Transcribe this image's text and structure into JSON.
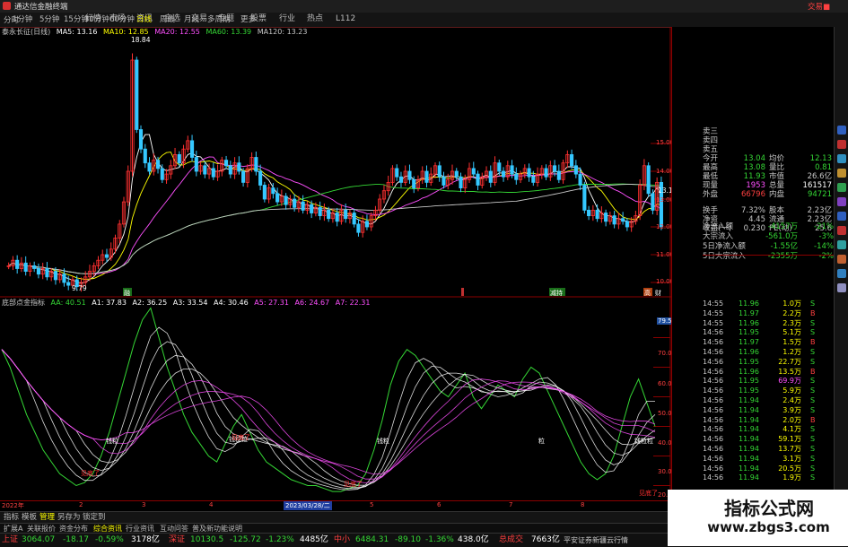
{
  "window": {
    "title": "通达信金融终端",
    "trade_link": "交易■"
  },
  "menu": [
    "行情",
    "市场",
    "资讯",
    "自选",
    "交易",
    "专题",
    "股票",
    "行业",
    "热点",
    "L112"
  ],
  "periods": [
    "分时",
    "1分钟",
    "5分钟",
    "15分钟",
    "30分钟",
    "60分钟",
    "日线",
    "周线",
    "月线",
    "多周期",
    "更多"
  ],
  "selected_period": "日线",
  "main_legend": {
    "name": "泰永长征(日线)",
    "items": [
      {
        "text": "MA5: 13.16",
        "color": "#ffffff"
      },
      {
        "text": "MA10: 12.85",
        "color": "#ffff00"
      },
      {
        "text": "MA20: 12.55",
        "color": "#ff50ff"
      },
      {
        "text": "MA60: 13.39",
        "color": "#35d835"
      },
      {
        "text": "MA120: 13.23",
        "color": "#c8c8c8"
      }
    ]
  },
  "price_axis": [
    "15.00",
    "14.00",
    "13.00",
    "12.00",
    "11.00",
    "10.00"
  ],
  "price_notes": {
    "high": "18.84",
    "low": "9.79",
    "last": "13.1"
  },
  "event_markers": [
    "融",
    "减持",
    "高",
    "财"
  ],
  "ind_legend": {
    "name": "底部点金指标",
    "items": [
      {
        "text": "AA: 40.51",
        "color": "#35d835"
      },
      {
        "text": "A1: 37.83",
        "color": "#ffffff"
      },
      {
        "text": "A2: 36.25",
        "color": "#ffffff"
      },
      {
        "text": "A3: 33.54",
        "color": "#ffffff"
      },
      {
        "text": "A4: 30.46",
        "color": "#ffffff"
      },
      {
        "text": "A5: 27.31",
        "color": "#ff50ff"
      },
      {
        "text": "A6: 24.67",
        "color": "#ff50ff"
      },
      {
        "text": "A7: 22.31",
        "color": "#ff50ff"
      }
    ]
  },
  "ind_axis": [
    "79.58",
    "70.00",
    "60.00",
    "50.00",
    "40.00",
    "30.00",
    "20.00"
  ],
  "ind_labels": [
    "见底了",
    "钱粒",
    "钱粒粒",
    "钱粒",
    "粒",
    "钱粒粒",
    "见底了",
    "见底了",
    "见底了"
  ],
  "time_axis": {
    "year": "2022年",
    "date": "2023/03/28/二",
    "marks": [
      "2",
      "3",
      "4",
      "5",
      "6",
      "7",
      "8"
    ]
  },
  "quote": {
    "bids_asks": [
      "卖三",
      "卖四",
      "卖五"
    ],
    "rows": [
      {
        "l1": "今开",
        "v1": "13.04",
        "c1": "#35d835",
        "l2": "均价",
        "v2": "12.13",
        "c2": "#35d835"
      },
      {
        "l1": "最高",
        "v1": "13.08",
        "c1": "#35d835",
        "l2": "量比",
        "v2": "0.81",
        "c2": "#35d835"
      },
      {
        "l1": "最低",
        "v1": "11.93",
        "c1": "#35d835",
        "l2": "市值",
        "v2": "26.6亿",
        "c2": "#c8c8c8"
      },
      {
        "l1": "现量",
        "v1": "1953",
        "c1": "#ff50ff",
        "l2": "总量",
        "v2": "161517",
        "c2": "#ffffff"
      },
      {
        "l1": "外盘",
        "v1": "66796",
        "c1": "#ff4040",
        "l2": "内盘",
        "v2": "94721",
        "c2": "#35d835"
      },
      {
        "l1": "换手",
        "v1": "7.32%",
        "c1": "#c8c8c8",
        "l2": "股本",
        "v2": "2.23亿",
        "c2": "#c8c8c8"
      },
      {
        "l1": "净资",
        "v1": "4.45",
        "c1": "#c8c8c8",
        "l2": "流通",
        "v2": "2.23亿",
        "c2": "#c8c8c8"
      },
      {
        "l1": "收益(一)",
        "v1": "0.230",
        "c1": "#c8c8c8",
        "l2": "PE(动)",
        "v2": "25.6",
        "c2": "#c8c8c8"
      }
    ],
    "flows": [
      {
        "label": "净流入额",
        "value": "-4157万",
        "pct": "-21%"
      },
      {
        "label": "大宗流入",
        "value": "-561.0万",
        "pct": "-3%"
      },
      {
        "label": "5日净流入额",
        "value": "-1.55亿",
        "pct": "-14%"
      },
      {
        "label": "5日大宗流入",
        "value": "-2355万",
        "pct": "-2%"
      }
    ]
  },
  "ticks": [
    {
      "t": "14:55",
      "p": "11.96",
      "v": "1.0万",
      "s": "S",
      "pc": "#35d835",
      "vc": "#ffff00",
      "sc": "#35d835"
    },
    {
      "t": "14:55",
      "p": "11.97",
      "v": "2.2万",
      "s": "B",
      "pc": "#35d835",
      "vc": "#ffff00",
      "sc": "#ff4040"
    },
    {
      "t": "14:55",
      "p": "11.96",
      "v": "2.3万",
      "s": "S",
      "pc": "#35d835",
      "vc": "#ffff00",
      "sc": "#35d835"
    },
    {
      "t": "14:56",
      "p": "11.95",
      "v": "5.1万",
      "s": "S",
      "pc": "#35d835",
      "vc": "#ffff00",
      "sc": "#35d835"
    },
    {
      "t": "14:56",
      "p": "11.97",
      "v": "1.5万",
      "s": "B",
      "pc": "#35d835",
      "vc": "#ffff00",
      "sc": "#ff4040"
    },
    {
      "t": "14:56",
      "p": "11.96",
      "v": "1.2万",
      "s": "S",
      "pc": "#35d835",
      "vc": "#ffff00",
      "sc": "#35d835"
    },
    {
      "t": "14:56",
      "p": "11.95",
      "v": "22.7万",
      "s": "S",
      "pc": "#35d835",
      "vc": "#ffff00",
      "sc": "#35d835"
    },
    {
      "t": "14:56",
      "p": "11.96",
      "v": "13.5万",
      "s": "B",
      "pc": "#35d835",
      "vc": "#ffff00",
      "sc": "#ff4040"
    },
    {
      "t": "14:56",
      "p": "11.95",
      "v": "69.9万",
      "s": "S",
      "pc": "#35d835",
      "vc": "#ff50ff",
      "sc": "#35d835"
    },
    {
      "t": "14:56",
      "p": "11.95",
      "v": "5.9万",
      "s": "S",
      "pc": "#35d835",
      "vc": "#ffff00",
      "sc": "#35d835"
    },
    {
      "t": "14:56",
      "p": "11.94",
      "v": "2.4万",
      "s": "S",
      "pc": "#35d835",
      "vc": "#ffff00",
      "sc": "#35d835"
    },
    {
      "t": "14:56",
      "p": "11.94",
      "v": "3.9万",
      "s": "S",
      "pc": "#35d835",
      "vc": "#ffff00",
      "sc": "#35d835"
    },
    {
      "t": "14:56",
      "p": "11.94",
      "v": "2.0万",
      "s": "B",
      "pc": "#35d835",
      "vc": "#ffff00",
      "sc": "#ff4040"
    },
    {
      "t": "14:56",
      "p": "11.94",
      "v": "4.1万",
      "s": "S",
      "pc": "#35d835",
      "vc": "#ffff00",
      "sc": "#35d835"
    },
    {
      "t": "14:56",
      "p": "11.94",
      "v": "59.1万",
      "s": "S",
      "pc": "#35d835",
      "vc": "#ffff00",
      "sc": "#35d835"
    },
    {
      "t": "14:56",
      "p": "11.94",
      "v": "13.7万",
      "s": "S",
      "pc": "#35d835",
      "vc": "#ffff00",
      "sc": "#35d835"
    },
    {
      "t": "14:56",
      "p": "11.94",
      "v": "3.1万",
      "s": "S",
      "pc": "#35d835",
      "vc": "#ffff00",
      "sc": "#35d835"
    },
    {
      "t": "14:56",
      "p": "11.94",
      "v": "20.5万",
      "s": "S",
      "pc": "#35d835",
      "vc": "#ffff00",
      "sc": "#35d835"
    },
    {
      "t": "14:56",
      "p": "11.94",
      "v": "1.9万",
      "s": "S",
      "pc": "#35d835",
      "vc": "#ffff00",
      "sc": "#35d835"
    }
  ],
  "tabs": [
    "指标",
    "模板",
    "管理",
    "另存为",
    "锁定到",
    "扩展A",
    "关联报价",
    "资金分布",
    "综合资讯",
    "行业资讯",
    "互动问答",
    "普及新功能说明"
  ],
  "selected_tab": "管理",
  "status": [
    {
      "name": "上证",
      "value": "3064.07",
      "chg": "-18.17",
      "pct": "-0.59%",
      "amt": "3178亿"
    },
    {
      "name": "深证",
      "value": "10130.5",
      "chg": "-125.72",
      "pct": "-1.23%",
      "amt": "4485亿"
    },
    {
      "name": "中小",
      "value": "6484.31",
      "chg": "-89.10",
      "pct": "-1.36%",
      "amt": "438.0亿"
    }
  ],
  "status_total": {
    "label": "总成交",
    "amt": "7663亿"
  },
  "status_source": "平安证券新疆云行情",
  "watermark": {
    "title": "指标公式网",
    "url": "www.zbgs3.com"
  }
}
